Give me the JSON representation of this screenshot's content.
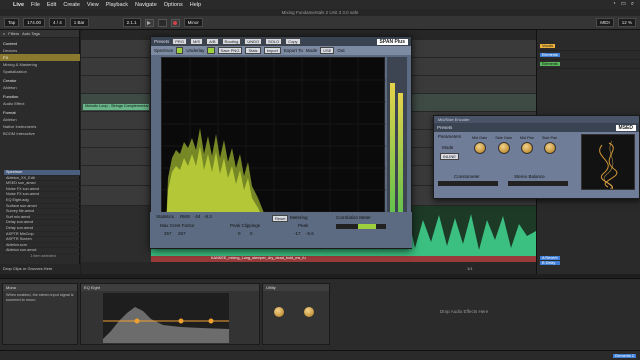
{
  "menubar": {
    "app": "Live",
    "items": [
      "File",
      "Edit",
      "Create",
      "View",
      "Playback",
      "Navigate",
      "Options",
      "Help"
    ]
  },
  "window": {
    "title": "Mixing Fundamentals 2 Unit 3 3.0 safe"
  },
  "transport": {
    "tap": "Tap",
    "tempo": "174.00",
    "meter": "4 / 4",
    "quantize": "1 Bar",
    "position": "2.1.1",
    "key": "Minor",
    "cpu": "MIDI",
    "zoom": "12 %"
  },
  "browser": {
    "tabs": [
      "Filters",
      "Auto Tags"
    ],
    "sections": [
      {
        "label": "Content",
        "title": true
      },
      {
        "label": "Devices"
      },
      {
        "label": "FX"
      },
      {
        "label": "Mixing & Mastering"
      },
      {
        "label": "Spatialization"
      },
      {
        "label": "Creator",
        "title": true
      },
      {
        "label": "Ableton"
      },
      {
        "label": "Function",
        "title": true
      },
      {
        "label": "Audio Effect"
      },
      {
        "label": "Format",
        "title": true
      },
      {
        "label": "Ableton"
      },
      {
        "label": "Native Instruments"
      },
      {
        "label": "BOOM Interactive"
      }
    ],
    "files": [
      "Spectrum",
      "Ableton_XX_Edit",
      "MSED sun_amxd",
      "Noise FX sun.amxd",
      "Noise FX sun.amxd",
      "EQ Eight.adg",
      "Surface sun.amxd",
      "Survey file.amxd",
      "Surf mix.amxd",
      "Delay sun.amxd",
      "Delay sun.amxd",
      "ASPTR MixCmp",
      "ASPTR Screen",
      "Ableton.scrn",
      "Ableton sun.amxd"
    ],
    "items_selected": "1 item selected",
    "footer": "Drop Clips or Grooves Here"
  },
  "span": {
    "presets": "Presets",
    "preset_name": "PRO",
    "mode": "M/S",
    "buttons": [
      "A/B",
      "Routing",
      "UNDO",
      "SOLO",
      "Copy"
    ],
    "logo": "SPAN Plus",
    "spectrum_label": "Spectrum",
    "underlay": "Underlay",
    "save_png": "Save PNG",
    "stats_btn": "Stats",
    "import": "Import",
    "export_to": "Export To",
    "mode_label": "Mode",
    "mode_value": "USE",
    "out_label": "Out",
    "statistics": "Statistics",
    "rms": "RMS",
    "rms_vals": [
      "-24",
      "-8.3"
    ],
    "max_crest_factor": "Max Crest Factor",
    "crest_vals": [
      "257",
      "257"
    ],
    "peak_clippings": "Peak Clippings",
    "clip_vals": [
      "0",
      "0"
    ],
    "peak": "Peak",
    "peak_vals": [
      "-17",
      "-5.6"
    ],
    "reset": "Reset",
    "metering": "Metering",
    "correlation_meter": "Correlation Meter"
  },
  "msed": {
    "title": "MSED",
    "window_title": "Mid/Side Encoder",
    "presets": "Presets",
    "parameters": "Parameters",
    "mode": "Mode",
    "mode_value": "INLINE",
    "knobs": [
      "Mid Gain",
      "Side Gain",
      "Mid Pan",
      "Side Pan"
    ],
    "controls": [
      "Constometer",
      "Stereo Balance"
    ]
  },
  "mixer": {
    "tracks": [
      {
        "name": "Vocals",
        "color": "#eab23a"
      },
      {
        "name": "Elements",
        "color": "#3f7fd6"
      },
      {
        "name": "Elements",
        "color": "#59b65b"
      }
    ],
    "returns": [
      "A Reverb",
      "B Delay",
      "LO MAIN"
    ]
  },
  "arrangement": {
    "clip_label": "Melodic Loop - Strings Complementary",
    "bottom_clip": "KANKEE_mixing_Long_stemper_dry_dead_bold_ms_fu",
    "marker": "1/1"
  },
  "devices": {
    "title": "Mono",
    "help": "When enabled, the stereo input signal is summed to mono.",
    "eq_name": "EQ Eight",
    "utility_name": "Utility",
    "drop_hint": "Drop Audio Effects Here"
  },
  "status": {
    "left": "",
    "right_chip": "Elements 2"
  }
}
